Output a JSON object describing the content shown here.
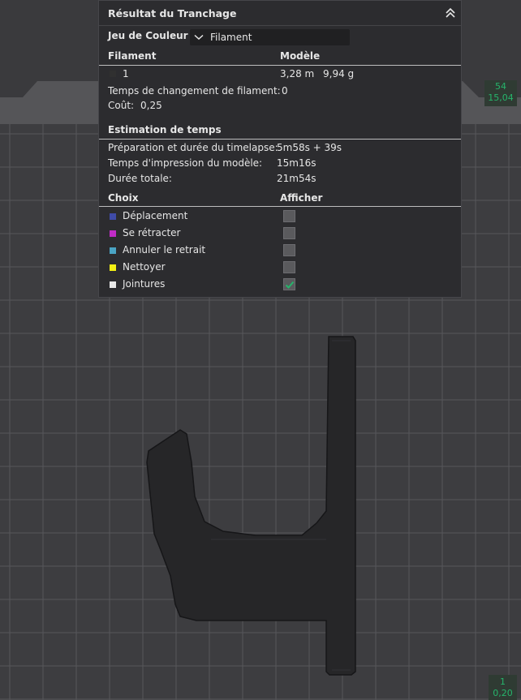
{
  "panel": {
    "title": "Résultat du Tranchage",
    "color_scheme_label": "Jeu de Couleur",
    "color_scheme_value": "Filament",
    "filament_header": "Filament",
    "model_header": "Modèle",
    "filament_id": "1",
    "filament_swatch": "#303030",
    "model_length": "3,28 m",
    "model_weight": "9,94 g",
    "change_time_label": "Temps de changement de filament:",
    "change_time_value": "0",
    "cost_label": "Coût:",
    "cost_value": "0,25",
    "time_section_title": "Estimation de temps",
    "prep_label": "Préparation et durée du timelapse:",
    "prep_value": "5m58s + 39s",
    "print_time_label": "Temps d'impression du modèle:",
    "print_time_value": "15m16s",
    "total_label": "Durée totale:",
    "total_value": "21m54s",
    "choice_header": "Choix",
    "show_header": "Afficher",
    "options": [
      {
        "label": "Déplacement",
        "color": "#3f4ba8",
        "checked": false
      },
      {
        "label": "Se rétracter",
        "color": "#c02bc6",
        "checked": false
      },
      {
        "label": "Annuler le retrait",
        "color": "#4aa4c4",
        "checked": false
      },
      {
        "label": "Nettoyer",
        "color": "#f2ef14",
        "checked": false
      },
      {
        "label": "Jointures",
        "color": "#e8e8e8",
        "checked": true
      }
    ]
  },
  "layer_slider": {
    "top_value": "54",
    "top_height": "15,04",
    "bottom_value": "1",
    "bottom_height": "0,20"
  },
  "colors": {
    "accent_green": "#26b46b",
    "background": "#3a3a3d",
    "bed": "#3d3d40",
    "bed_grid": "#56565a"
  }
}
